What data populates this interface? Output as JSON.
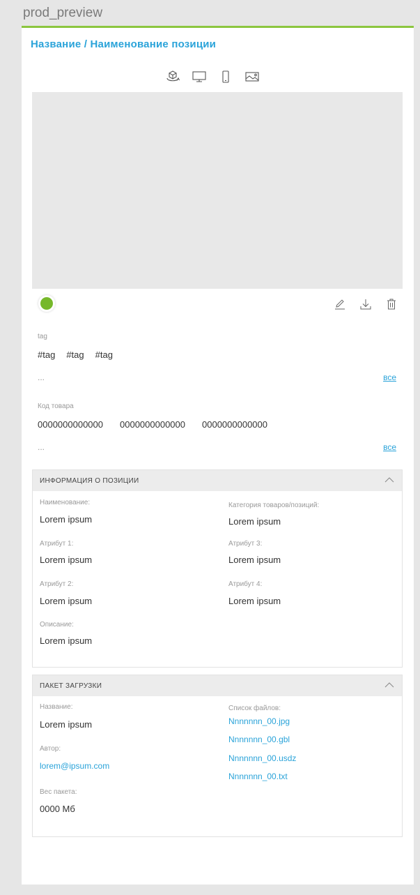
{
  "window": {
    "title": "prod_preview"
  },
  "product": {
    "title": "Название / Наименование позиции"
  },
  "view_tabs": [
    {
      "name": "3d-view",
      "icon": "cube-rotate-icon"
    },
    {
      "name": "desktop",
      "icon": "monitor-icon"
    },
    {
      "name": "mobile",
      "icon": "phone-icon"
    },
    {
      "name": "image",
      "icon": "image-icon"
    }
  ],
  "status": {
    "color": "#76b82a"
  },
  "actions": {
    "edit_icon": "pencil-icon",
    "download_icon": "download-icon",
    "delete_icon": "trash-icon"
  },
  "tags": {
    "label": "tag",
    "items": [
      "#tag",
      "#tag",
      "#tag"
    ],
    "more": "...",
    "all_link": "все"
  },
  "codes": {
    "label": "Код товара",
    "items": [
      "0000000000000",
      "0000000000000",
      "0000000000000"
    ],
    "more": "...",
    "all_link": "все"
  },
  "info_section": {
    "title": "ИНФОРМАЦИЯ О ПОЗИЦИИ",
    "left": [
      {
        "label": "Наименование:",
        "value": "Lorem ipsum"
      },
      {
        "label": "Атрибут 1:",
        "value": "Lorem ipsum"
      },
      {
        "label": "Атрибут 2:",
        "value": "Lorem ipsum"
      },
      {
        "label": "Описание:",
        "value": "Lorem ipsum"
      }
    ],
    "right": [
      {
        "label": "Категория товаров/позиций:",
        "value": "Lorem ipsum"
      },
      {
        "label": "Атрибут 3:",
        "value": "Lorem ipsum"
      },
      {
        "label": "Атрибут 4:",
        "value": "Lorem ipsum"
      }
    ]
  },
  "package_section": {
    "title": "ПАКЕТ ЗАГРУЗКИ",
    "name_label": "Название:",
    "name_value": "Lorem ipsum",
    "author_label": "Автор:",
    "author_value": "lorem@ipsum.com",
    "size_label": "Вес пакета:",
    "size_value": "0000 Мб",
    "files_label": "Список файлов:",
    "files": [
      "Nnnnnnn_00.jpg",
      "Nnnnnnn_00.gbl",
      "Nnnnnnn_00.usdz",
      "Nnnnnnn_00.txt"
    ]
  },
  "colors": {
    "accent": "#2aa3d9",
    "header_border": "#8cc63f"
  }
}
